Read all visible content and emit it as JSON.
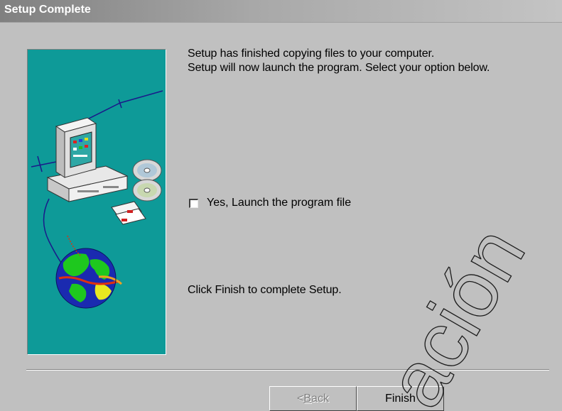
{
  "window": {
    "title": "Setup Complete"
  },
  "message": {
    "line1": "Setup has finished copying files to your computer.",
    "line2": "Setup will now launch the program. Select your option below."
  },
  "launch_option": {
    "label": "Yes, Launch the program file",
    "checked": false
  },
  "finish_message": "Click Finish to complete Setup.",
  "buttons": {
    "back_label": "< Back",
    "finish_label": "Finish"
  },
  "watermark": {
    "text": "ación"
  },
  "colors": {
    "banner_background": "#0e9a98",
    "dialog_background": "#c0c0c0"
  },
  "icons": [
    "computer-icon",
    "cd-icon",
    "floppy-icon",
    "globe-icon"
  ]
}
